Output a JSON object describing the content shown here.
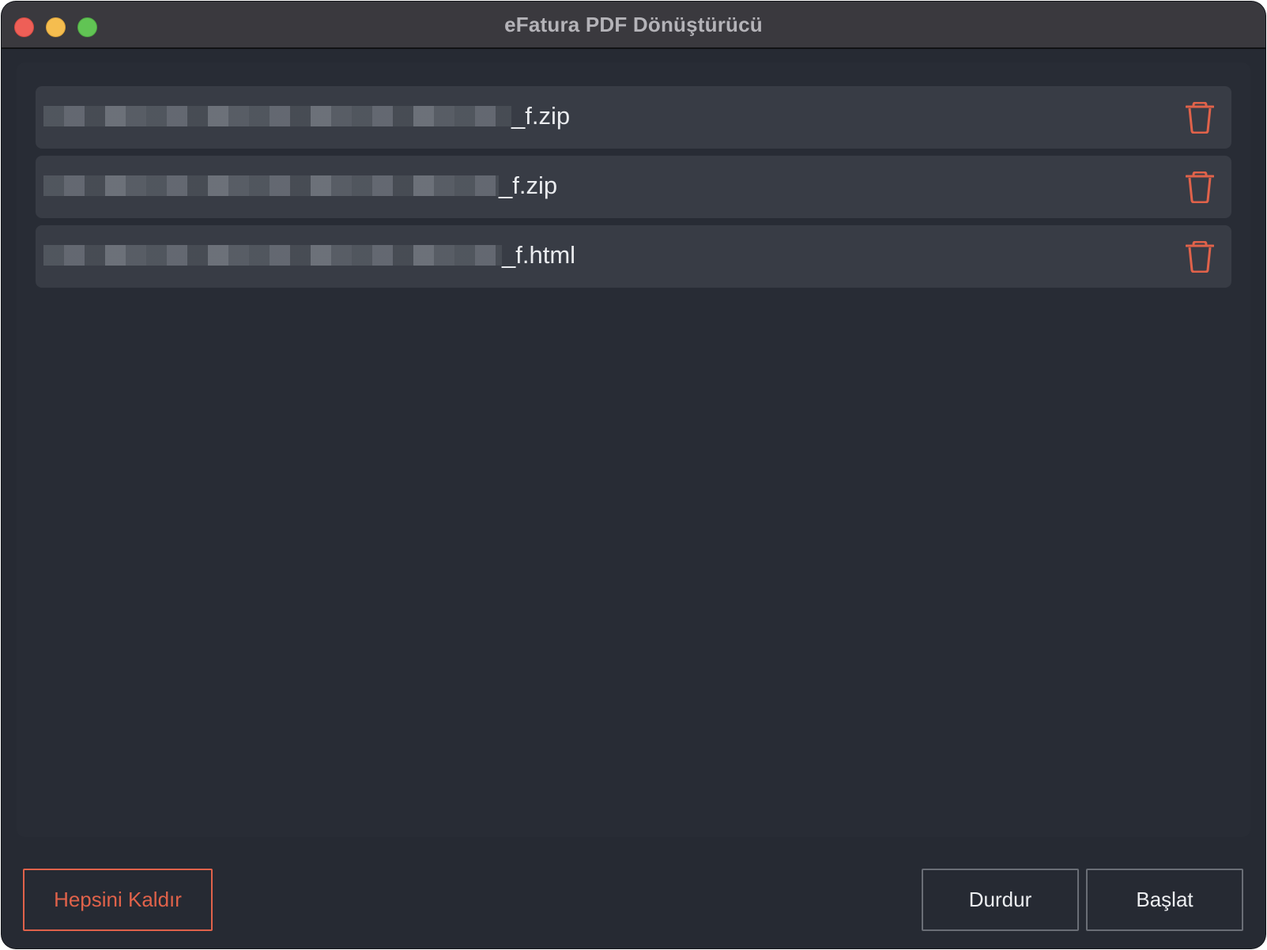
{
  "window": {
    "title": "eFatura PDF Dönüştürücü"
  },
  "files": [
    {
      "name_suffix": "_f.zip",
      "redacted": true
    },
    {
      "name_suffix": "_f.zip",
      "redacted": true
    },
    {
      "name_suffix": "_f.html",
      "redacted": true
    }
  ],
  "icons": {
    "delete": "trash-icon"
  },
  "footer": {
    "remove_all_label": "Hepsini Kaldır",
    "stop_label": "Durdur",
    "start_label": "Başlat"
  },
  "colors": {
    "accent_danger": "#e0624a",
    "background": "#262a33",
    "row_background": "#383c45",
    "titlebar": "#3a393e"
  }
}
